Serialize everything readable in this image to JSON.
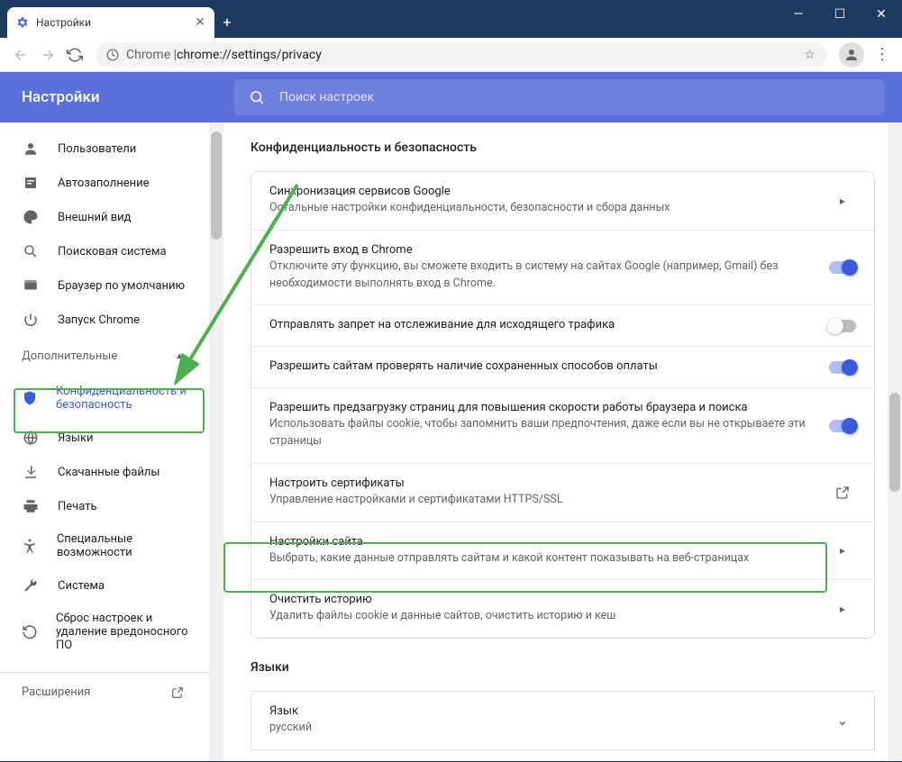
{
  "window": {
    "tab_title": "Настройки",
    "url_prefix": "Chrome | ",
    "url_path": "chrome://settings/privacy"
  },
  "header": {
    "title": "Настройки",
    "search_placeholder": "Поиск настроек"
  },
  "sidebar": {
    "items": [
      {
        "label": "Пользователи"
      },
      {
        "label": "Автозаполнение"
      },
      {
        "label": "Внешний вид"
      },
      {
        "label": "Поисковая система"
      },
      {
        "label": "Браузер по умолчанию"
      },
      {
        "label": "Запуск Chrome"
      }
    ],
    "advanced": "Дополнительные",
    "adv_items": [
      {
        "label": "Конфиденциальность и безопасность"
      },
      {
        "label": "Языки"
      },
      {
        "label": "Скачанные файлы"
      },
      {
        "label": "Печать"
      },
      {
        "label": "Специальные возможности"
      },
      {
        "label": "Система"
      },
      {
        "label": "Сброс настроек и удаление вредоносного ПО"
      }
    ],
    "extensions": "Расширения"
  },
  "main": {
    "section_title": "Конфиденциальность и безопасность",
    "rows": [
      {
        "t1": "Синхронизация сервисов Google",
        "t2": "Остальные настройки конфиденциальности, безопасности и сбора данных",
        "action": "chevron"
      },
      {
        "t1": "Разрешить вход в Chrome",
        "t2": "Отключите эту функцию, вы сможете входить в систему на сайтах Google (например, Gmail) без необходимости выполнять вход в Chrome.",
        "action": "toggle-on"
      },
      {
        "t1": "Отправлять запрет на отслеживание для исходящего трафика",
        "t2": "",
        "action": "toggle-off"
      },
      {
        "t1": "Разрешить сайтам проверять наличие сохраненных способов оплаты",
        "t2": "",
        "action": "toggle-on"
      },
      {
        "t1": "Разрешить предзагрузку страниц для повышения скорости работы браузера и поиска",
        "t2": "Использовать файлы cookie, чтобы запомнить ваши предпочтения, даже если вы не открываете эти страницы",
        "action": "toggle-on"
      },
      {
        "t1": "Настроить сертификаты",
        "t2": "Управление настройками и сертификатами HTTPS/SSL",
        "action": "launch"
      },
      {
        "t1": "Настройки сайта",
        "t2": "Выбрать, какие данные отправлять сайтам и какой контент показывать на веб-страницах",
        "action": "chevron"
      },
      {
        "t1": "Очистить историю",
        "t2": "Удалить файлы cookie и данные сайтов, очистить историю и кеш",
        "action": "chevron"
      }
    ],
    "sec2_title": "Языки",
    "lang_row": {
      "t1": "Язык",
      "t2": "русский"
    }
  }
}
